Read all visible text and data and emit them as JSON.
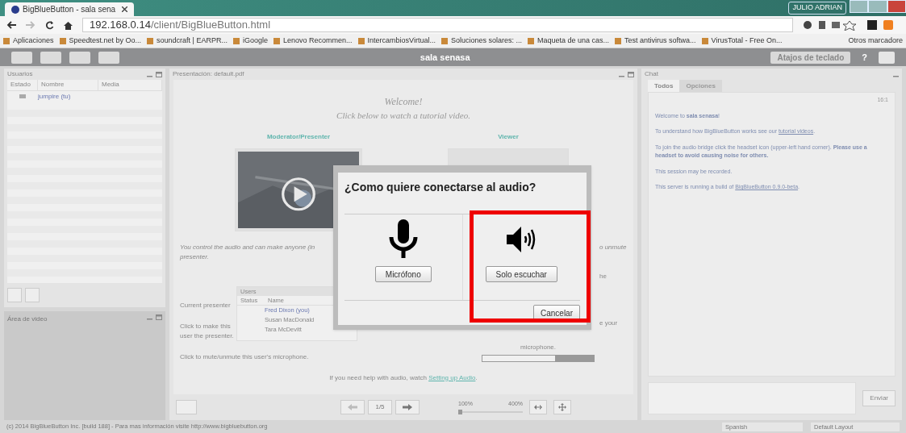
{
  "browser": {
    "tab_title": "BigBlueButton - sala sena",
    "user_badge": "JULIO ADRIAN",
    "url_host": "192.168.0.14",
    "url_path": "/client/BigBlueButton.html",
    "bookmarks": [
      "Aplicaciones",
      "Speedtest.net by Oo...",
      "soundcraft | EARPR...",
      "iGoogle",
      "Lenovo Recommen...",
      "IntercambiosVirtual...",
      "Soluciones solares: ...",
      "Maqueta de una cas...",
      "Test antivirus softwa...",
      "VirusTotal - Free On..."
    ],
    "other_bookmarks": "Otros marcadore"
  },
  "toolbar": {
    "title": "sala senasa",
    "shortcuts_button": "Atajos de teclado",
    "help_button": "?"
  },
  "users_panel": {
    "title": "Usuarios",
    "columns": [
      "Estado",
      "Nombre",
      "Media"
    ],
    "rows": [
      {
        "name": "jumpire (tu)"
      }
    ]
  },
  "video_panel": {
    "title": "Área de video"
  },
  "presentation": {
    "title": "Presentación: default.pdf",
    "welcome": "Welcome!",
    "subtitle": "Click below to watch a tutorial video.",
    "moderator_heading": "Moderator/Presenter",
    "viewer_heading": "Viewer",
    "control_text": "You control the audio and can make anyone (in",
    "control_text_2": "presenter.",
    "right_fragments": [
      "o unmute",
      "he",
      "e your",
      "microphone."
    ],
    "mini_table": {
      "title": "Users",
      "columns": [
        "Status",
        "Name"
      ],
      "rows": [
        "Fred Dixon (you)",
        "Susan MacDonald",
        "Tara McDevitt"
      ]
    },
    "current_presenter": "Current presenter",
    "make_presenter": "Click to make this user the presenter.",
    "mute_hint": "Click to mute/unmute this user's microphone.",
    "help_text": "If you need help with audio, watch",
    "help_link": "Setting up Audio",
    "help_end": ".",
    "page": "1/5",
    "zoom_min": "100%",
    "zoom_max": "400%",
    "zoom_slider": {
      "level": 0
    }
  },
  "chat": {
    "title": "Chat",
    "tabs": [
      {
        "label": "Todos",
        "selected": true
      },
      {
        "label": "Opciones",
        "selected": false
      }
    ],
    "time": "16:1",
    "messages": [
      {
        "text": "Welcome to **sala senasa**!"
      },
      {
        "text": "To understand how BigBlueButton works see our",
        "link": "tutorial videos",
        "end": "."
      },
      {
        "text": "To join the audio bridge click the headset icon (upper-left hand corner). **Please use a headset to avoid causing noise for others.**"
      },
      {
        "text": "This session may be recorded."
      },
      {
        "text": "This server is running a build of",
        "link": "BigBlueButton 0.9.0-beta",
        "end": "."
      }
    ],
    "send_button": "Enviar"
  },
  "dialog": {
    "title": "¿Como quiere conectarse al audio?",
    "options": [
      {
        "kind": "microphone",
        "label": "Micrófono",
        "highlighted": false
      },
      {
        "kind": "listen",
        "label": "Solo escuchar",
        "highlighted": true
      }
    ],
    "cancel": "Cancelar"
  },
  "footer": {
    "copyright": "(c) 2014 BigBlueButton Inc. [build 188] - Para mas información visite http://www.bigbluebutton.org",
    "language": "Spanish",
    "layout": "Default Layout"
  }
}
